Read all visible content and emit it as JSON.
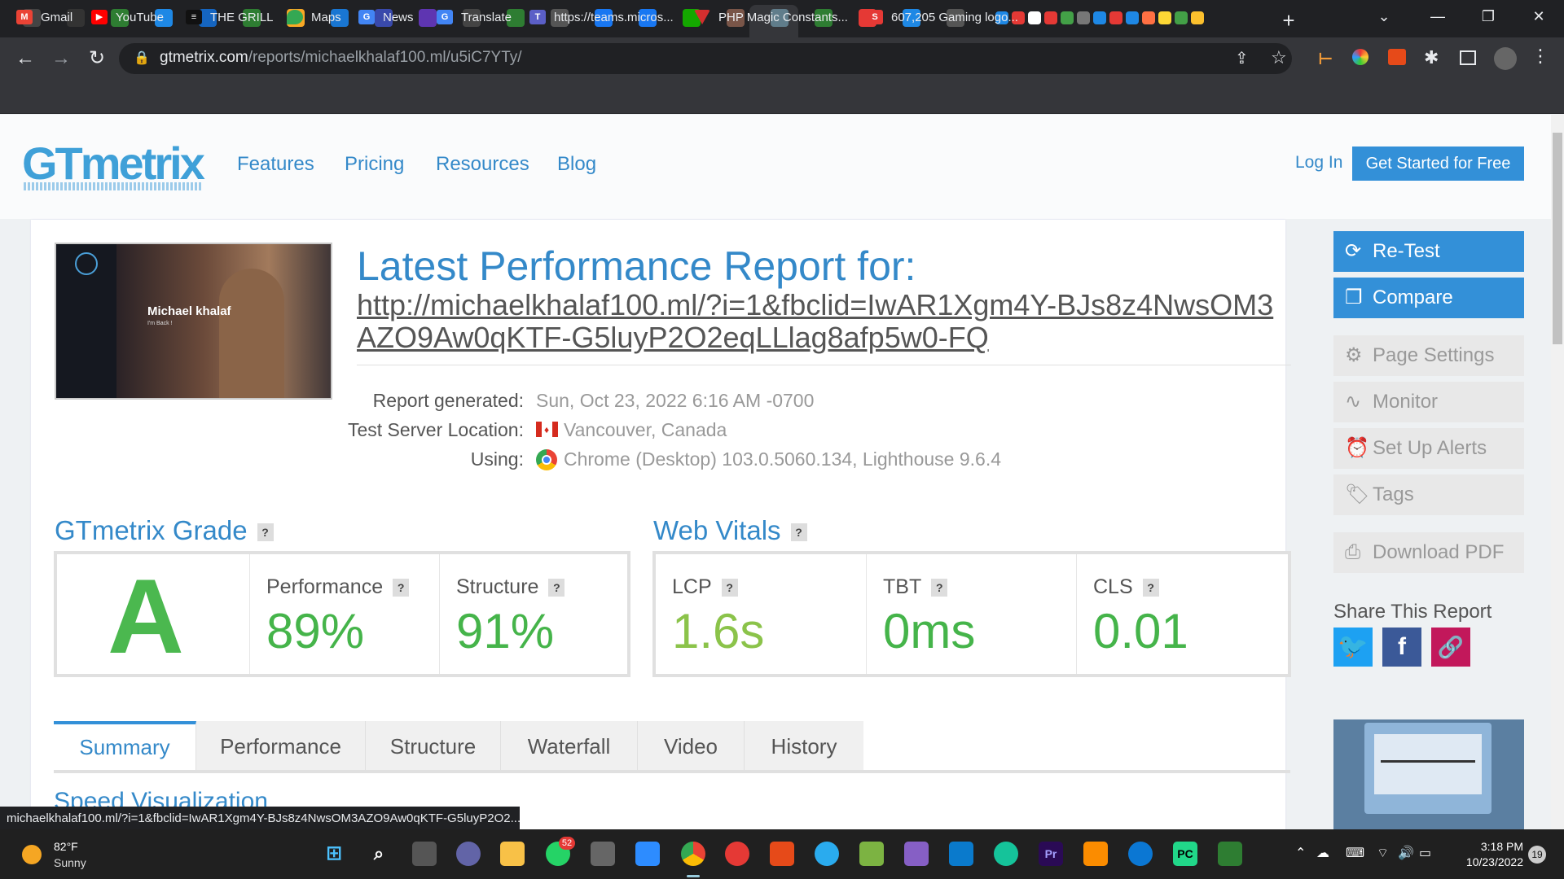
{
  "browser": {
    "url_host": "gtmetrix.com",
    "url_path": "/reports/michaelkhalaf100.ml/u5iC7YTy/",
    "bookmarks": [
      "Gmail",
      "YouTube",
      "THE GRILL",
      "Maps",
      "News",
      "Translate",
      "https://teams.micros...",
      "PHP Magic Constants...",
      "607,205 Gaming logo..."
    ],
    "status_url": "michaelkhalaf100.ml/?i=1&fbclid=IwAR1Xgm4Y-BJs8z4NwsOM3AZO9Aw0qKTF-G5luyP2O2..."
  },
  "site": {
    "logo": "GTmetrix",
    "nav": [
      "Features",
      "Pricing",
      "Resources",
      "Blog"
    ],
    "login": "Log In",
    "cta": "Get Started for Free"
  },
  "report": {
    "thumb_name": "Michael khalaf",
    "thumb_sub": "I'm Back !",
    "title": "Latest Performance Report for:",
    "url": "http://michaelkhalaf100.ml/?i=1&fbclid=IwAR1Xgm4Y-BJs8z4NwsOM3AZO9Aw0qKTF-G5luyP2O2eqLLlag8afp5w0-FQ",
    "generated_label": "Report generated:",
    "generated_value": "Sun, Oct 23, 2022 6:16 AM -0700",
    "location_label": "Test Server Location:",
    "location_value": "Vancouver, Canada",
    "using_label": "Using:",
    "using_value": "Chrome (Desktop) 103.0.5060.134, Lighthouse 9.6.4"
  },
  "grade": {
    "title": "GTmetrix Grade",
    "letter": "A",
    "performance_label": "Performance",
    "performance_value": "89%",
    "structure_label": "Structure",
    "structure_value": "91%"
  },
  "vitals": {
    "title": "Web Vitals",
    "lcp_label": "LCP",
    "lcp_value": "1.6s",
    "tbt_label": "TBT",
    "tbt_value": "0ms",
    "cls_label": "CLS",
    "cls_value": "0.01"
  },
  "qmark": "?",
  "tabs": [
    "Summary",
    "Performance",
    "Structure",
    "Waterfall",
    "Video",
    "History"
  ],
  "speed_title": "Speed Visualization",
  "sidebar": {
    "retest": "Re-Test",
    "compare": "Compare",
    "page_settings": "Page Settings",
    "monitor": "Monitor",
    "alerts": "Set Up Alerts",
    "tags": "Tags",
    "download": "Download PDF",
    "share_title": "Share This Report"
  },
  "taskbar": {
    "temp": "82°F",
    "weather": "Sunny",
    "time": "3:18 PM",
    "date": "10/23/2022",
    "notifications": "19",
    "whatsapp_badge": "52"
  },
  "colors": {
    "accent": "#3489c9",
    "good": "#45b44a",
    "button": "#3390d8"
  }
}
